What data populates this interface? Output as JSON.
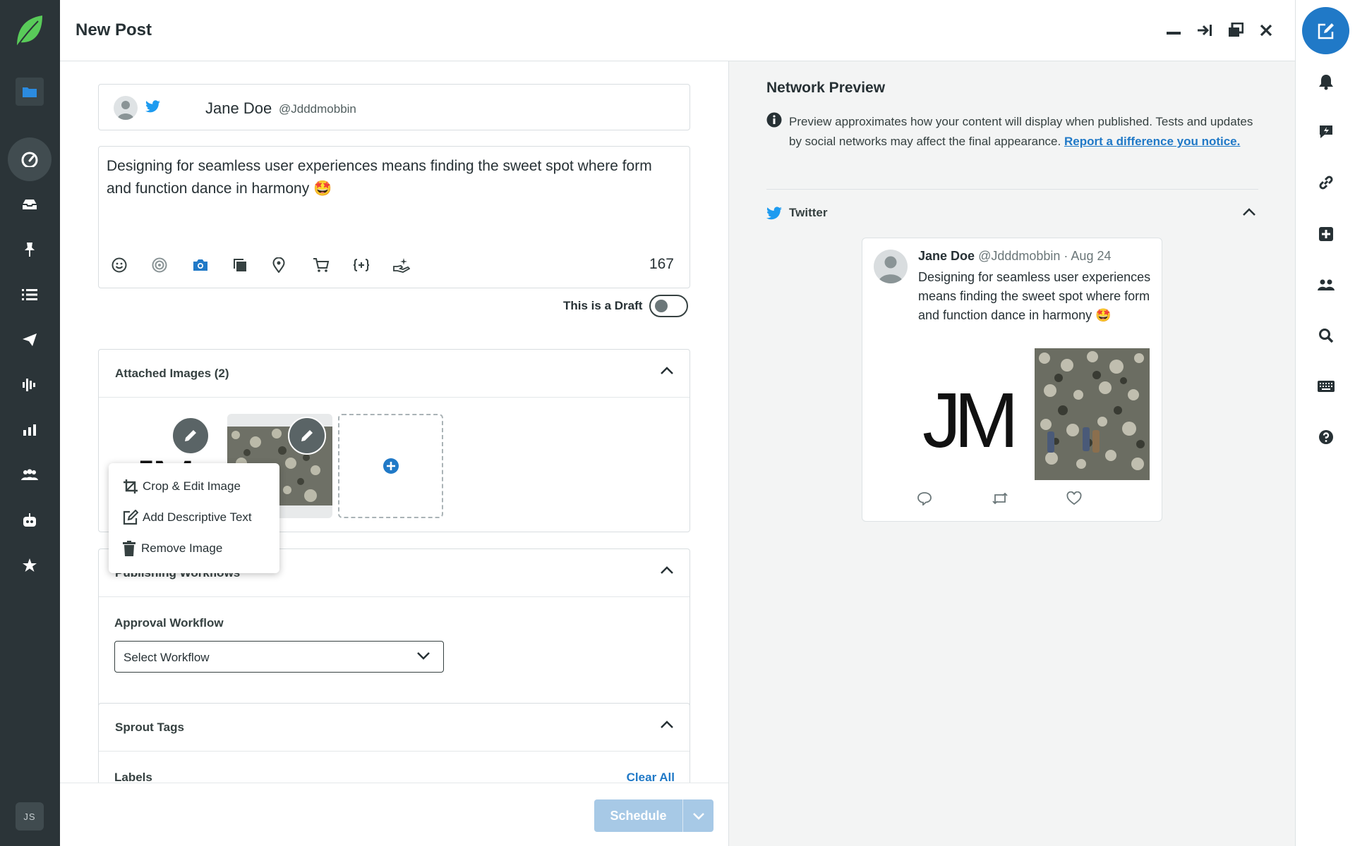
{
  "header": {
    "title": "New Post"
  },
  "profile": {
    "name": "Jane Doe",
    "handle": "@Jdddmobbin"
  },
  "editor": {
    "text": "Designing for seamless user experiences means finding the sweet spot where form and function dance in harmony 🤩",
    "char_count": "167"
  },
  "draft": {
    "label": "This is a Draft",
    "enabled": false
  },
  "images": {
    "header": "Attached Images (2)",
    "thumb1_text": "JM"
  },
  "context_menu": {
    "items": [
      {
        "label": "Crop & Edit Image",
        "icon": "crop-icon"
      },
      {
        "label": "Add Descriptive Text",
        "icon": "edit-text-icon"
      },
      {
        "label": "Remove Image",
        "icon": "trash-icon"
      }
    ]
  },
  "workflows": {
    "header": "Publishing Workflows",
    "approval_label": "Approval Workflow",
    "select_value": "Select Workflow"
  },
  "tags": {
    "header": "Sprout Tags",
    "labels_label": "Labels",
    "clear_all": "Clear All"
  },
  "footer": {
    "schedule_label": "Schedule"
  },
  "preview": {
    "title": "Network Preview",
    "info_text": "Preview approximates how your content will display when published. Tests and updates by social networks may affect the final appearance.",
    "info_link": "Report a difference you notice.",
    "network_label": "Twitter",
    "tweet": {
      "name": "Jane Doe",
      "handle": "@Jdddmobbin",
      "date": "· Aug 24",
      "body": "Designing for seamless user experiences means finding the sweet spot where form and function dance in harmony 🤩",
      "image1_text": "JM"
    }
  },
  "user": {
    "initials": "JS"
  },
  "colors": {
    "accent": "#2079c7",
    "nav_bg": "#2b3438",
    "brand_green": "#59cb59",
    "schedule_disabled": "#a7c9e6"
  }
}
